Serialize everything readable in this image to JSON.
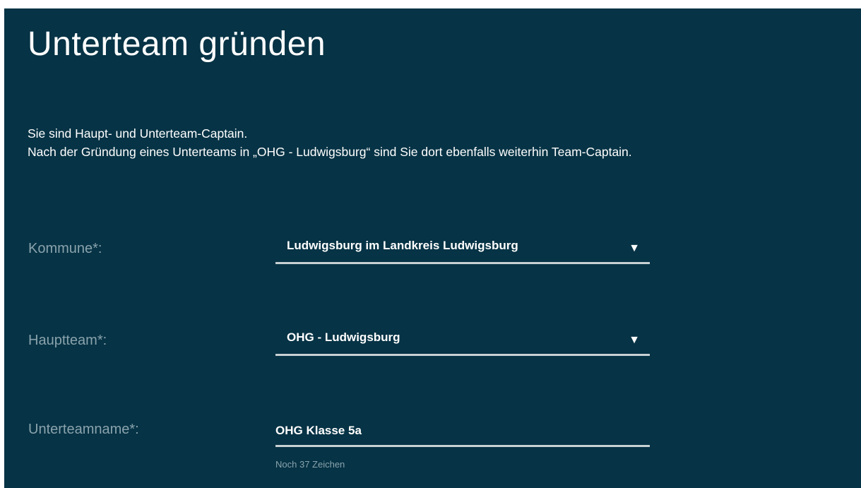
{
  "page": {
    "title": "Unterteam gründen",
    "intro_line1": "Sie sind Haupt- und Unterteam-Captain.",
    "intro_line2": "Nach der Gründung eines Unterteams in „OHG - Ludwigsburg“ sind Sie dort ebenfalls weiterhin Team-Captain."
  },
  "form": {
    "kommune": {
      "label": "Kommune*:",
      "value": "Ludwigsburg im Landkreis Ludwigsburg",
      "icon": "triangle-down-icon"
    },
    "hauptteam": {
      "label": "Hauptteam*:",
      "value": "OHG - Ludwigsburg",
      "icon": "triangle-down-icon"
    },
    "unterteamname": {
      "label": "Unterteamname*:",
      "value": "OHG Klasse 5a",
      "hint": "Noch 37 Zeichen"
    }
  },
  "colors": {
    "panel_background": "#063345",
    "label_text": "#8aa3ad",
    "underline": "#c7d0d3"
  }
}
